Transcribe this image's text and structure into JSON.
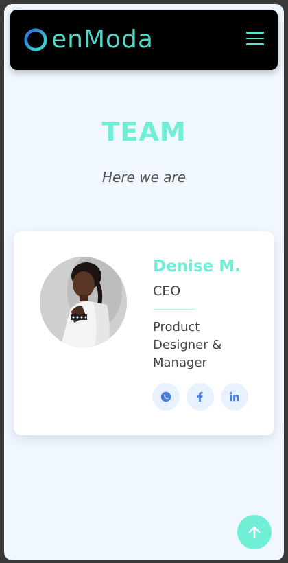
{
  "header": {
    "logo_text": "enModa",
    "menu_icon": "hamburger-menu-icon",
    "brand_color": "#70efd6"
  },
  "team": {
    "title": "TEAM",
    "subtitle": "Here we are"
  },
  "member": {
    "name": "Denise M.",
    "role": "CEO",
    "description": "Product Designer & Manager",
    "socials": [
      {
        "icon": "whatsapp-icon"
      },
      {
        "icon": "facebook-icon"
      },
      {
        "icon": "linkedin-icon"
      }
    ]
  },
  "scroll_top": {
    "icon": "arrow-up-icon"
  }
}
